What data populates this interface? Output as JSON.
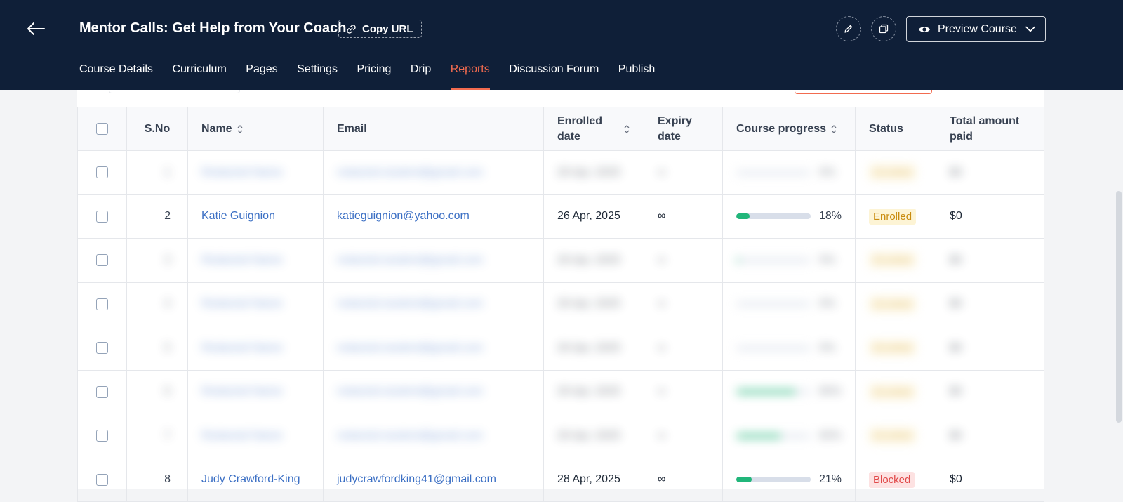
{
  "header": {
    "course_title": "Mentor Calls: Get Help from Your Coach",
    "copy_url_label": "Copy URL",
    "preview_label": "Preview Course",
    "icons": {
      "back": "arrow-left-icon",
      "link": "link-icon",
      "edit": "pencil-icon",
      "duplicate": "copy-icon",
      "eye": "eye-icon",
      "chevron": "chevron-down-icon"
    },
    "tabs": [
      {
        "label": "Course Details",
        "active": false
      },
      {
        "label": "Curriculum",
        "active": false
      },
      {
        "label": "Pages",
        "active": false
      },
      {
        "label": "Settings",
        "active": false
      },
      {
        "label": "Pricing",
        "active": false
      },
      {
        "label": "Drip",
        "active": false
      },
      {
        "label": "Reports",
        "active": true
      },
      {
        "label": "Discussion Forum",
        "active": false
      },
      {
        "label": "Publish",
        "active": false
      }
    ]
  },
  "colors": {
    "header_bg": "#0f1f38",
    "accent": "#f26b4f",
    "link": "#3b6fc4",
    "progress": "#21b67a",
    "enrolled_badge_text": "#c98b0e",
    "blocked_badge_text": "#e04848"
  },
  "table": {
    "columns": {
      "sno": "S.No",
      "name": "Name",
      "email": "Email",
      "enrolled_line1": "Enrolled",
      "enrolled_line2": "date",
      "expiry_line1": "Expiry",
      "expiry_line2": "date",
      "progress": "Course progress",
      "status": "Status",
      "amount_line1": "Total amount",
      "amount_line2": "paid"
    },
    "rows": [
      {
        "sno": "1",
        "name": "Redacted Name",
        "email": "redacted.student@gmail.com",
        "enrolled": "26 Apr, 2025",
        "expiry": "∞",
        "progress": 0,
        "progress_label": "0%",
        "status": "Enrolled",
        "amount": "$0",
        "blurred": true
      },
      {
        "sno": "2",
        "name": "Katie Guignion",
        "email": "katieguignion@yahoo.com",
        "enrolled": "26 Apr, 2025",
        "expiry": "∞",
        "progress": 0.18,
        "progress_label": "18%",
        "status": "Enrolled",
        "amount": "$0",
        "blurred": false
      },
      {
        "sno": "3",
        "name": "Redacted Name",
        "email": "redacted.student@gmail.com",
        "enrolled": "26 Apr, 2025",
        "expiry": "∞",
        "progress": 0.05,
        "progress_label": "5%",
        "status": "Enrolled",
        "amount": "$0",
        "blurred": true
      },
      {
        "sno": "4",
        "name": "Redacted Name",
        "email": "redacted.student@gmail.com",
        "enrolled": "26 Apr, 2025",
        "expiry": "∞",
        "progress": 0,
        "progress_label": "0%",
        "status": "Enrolled",
        "amount": "$0",
        "blurred": true
      },
      {
        "sno": "5",
        "name": "Redacted Name",
        "email": "redacted.student@gmail.com",
        "enrolled": "26 Apr, 2025",
        "expiry": "∞",
        "progress": 0,
        "progress_label": "0%",
        "status": "Enrolled",
        "amount": "$0",
        "blurred": true
      },
      {
        "sno": "6",
        "name": "Redacted Name",
        "email": "redacted.student@gmail.com",
        "enrolled": "26 Apr, 2025",
        "expiry": "∞",
        "progress": 0.8,
        "progress_label": "80%",
        "status": "Enrolled",
        "amount": "$0",
        "blurred": true
      },
      {
        "sno": "7",
        "name": "Redacted Name",
        "email": "redacted.student@gmail.com",
        "enrolled": "26 Apr, 2025",
        "expiry": "∞",
        "progress": 0.6,
        "progress_label": "60%",
        "status": "Enrolled",
        "amount": "$0",
        "blurred": true
      },
      {
        "sno": "8",
        "name": "Judy Crawford-King",
        "email": "judycrawfordking41@gmail.com",
        "enrolled": "28 Apr, 2025",
        "expiry": "∞",
        "progress": 0.21,
        "progress_label": "21%",
        "status": "Blocked",
        "amount": "$0",
        "blurred": false
      }
    ]
  }
}
